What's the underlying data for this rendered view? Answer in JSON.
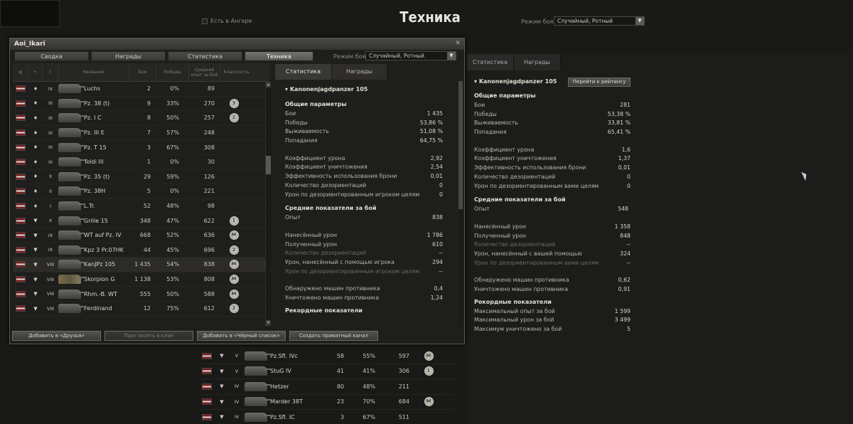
{
  "page_title": "Техника",
  "hangar_checkbox_label": "Есть в Ангаре",
  "battle_mode_label": "Режим боя:",
  "battle_mode_value": "Случайный, Ротный",
  "right_panel": {
    "tabs": [
      "Статистика",
      "Награды"
    ],
    "tank_name": "Kanonenjagdpanzer 105",
    "rating_button": "Перейти к рейтингу",
    "general_title": "Общие параметры",
    "general": [
      {
        "label": "Бои",
        "value": "281"
      },
      {
        "label": "Победы",
        "value": "53,38 %"
      },
      {
        "label": "Выживаемость",
        "value": "33,81 %"
      },
      {
        "label": "Попадания",
        "value": "65,41 %"
      }
    ],
    "coef": [
      {
        "label": "Коэффициент урона",
        "value": "1,6"
      },
      {
        "label": "Коэффициент уничтожения",
        "value": "1,37"
      },
      {
        "label": "Эффективность использования брони",
        "value": "0,01"
      },
      {
        "label": "Количество дезориентаций",
        "value": "0"
      },
      {
        "label": "Урон по дезориентированным вами целям",
        "value": "0"
      }
    ],
    "avg_title": "Средние показатели за бой",
    "avg_exp": {
      "label": "Опыт",
      "value": "548"
    },
    "avg_dmg": [
      {
        "label": "Нанесённый урон",
        "value": "1 358"
      },
      {
        "label": "Полученный урон",
        "value": "848"
      },
      {
        "label": "Количество дезориентаций",
        "value": "--"
      },
      {
        "label": "Урон, нанесённый с вашей помощью",
        "value": "324"
      },
      {
        "label": "Урон по дезориентированным вами целям",
        "value": "--"
      }
    ],
    "avg_det": [
      {
        "label": "Обнаружено машин противника",
        "value": "0,62"
      },
      {
        "label": "Уничтожено машин противника",
        "value": "0,91"
      }
    ],
    "record_title": "Рекордные показатели",
    "records": [
      {
        "label": "Максимальный опыт за бой",
        "value": "1 599"
      },
      {
        "label": "Максимальный урон за бой",
        "value": "3 499"
      },
      {
        "label": "Максимум уничтожено за бой",
        "value": "5"
      }
    ]
  },
  "window": {
    "title": "Aoi_Ikari",
    "close_glyph": "✕",
    "tabs": [
      "Сводка",
      "Награды",
      "Статистика",
      "Техника"
    ],
    "mode_label": "Режим боя:",
    "mode_value": "Случайный, Ротный",
    "headers": {
      "name": "Название",
      "battles": "Бои",
      "wins": "Победы",
      "exp_line1": "Средний",
      "exp_line2": "опыт за бой",
      "mastery": "Классность"
    },
    "rows": [
      {
        "type": "♦",
        "tier": "IV",
        "name": "Luchs",
        "battles": "2",
        "wins": "0%",
        "exp": "89",
        "badge": ""
      },
      {
        "type": "♦",
        "tier": "III",
        "name": "Pz. 38 (t)",
        "battles": "9",
        "wins": "33%",
        "exp": "270",
        "badge": "3"
      },
      {
        "type": "♦",
        "tier": "III",
        "name": "Pz. I C",
        "battles": "8",
        "wins": "50%",
        "exp": "257",
        "badge": "2"
      },
      {
        "type": "♦",
        "tier": "III",
        "name": "Pz. III E",
        "battles": "7",
        "wins": "57%",
        "exp": "248",
        "badge": ""
      },
      {
        "type": "♦",
        "tier": "III",
        "name": "Pz. T 15",
        "battles": "3",
        "wins": "67%",
        "exp": "308",
        "badge": ""
      },
      {
        "type": "♦",
        "tier": "III",
        "name": "Toldi III",
        "battles": "1",
        "wins": "0%",
        "exp": "30",
        "badge": ""
      },
      {
        "type": "♦",
        "tier": "II",
        "name": "Pz. 35 (t)",
        "battles": "29",
        "wins": "59%",
        "exp": "126",
        "badge": ""
      },
      {
        "type": "♦",
        "tier": "II",
        "name": "Pz. 38H",
        "battles": "5",
        "wins": "0%",
        "exp": "221",
        "badge": ""
      },
      {
        "type": "♦",
        "tier": "I",
        "name": "L.Tr.",
        "battles": "52",
        "wins": "48%",
        "exp": "98",
        "badge": ""
      },
      {
        "type": "▼",
        "tier": "X",
        "name": "Grille 15",
        "battles": "348",
        "wins": "47%",
        "exp": "622",
        "badge": "1"
      },
      {
        "type": "▼",
        "tier": "IX",
        "name": "WT auf Pz. IV",
        "battles": "668",
        "wins": "52%",
        "exp": "636",
        "badge": "M"
      },
      {
        "type": "▼",
        "tier": "IX",
        "name": "Kpz 3 Pr.07HK",
        "battles": "44",
        "wins": "45%",
        "exp": "696",
        "badge": "2"
      },
      {
        "type": "▼",
        "tier": "VIII",
        "name": "KanJPz 105",
        "battles": "1 435",
        "wins": "54%",
        "exp": "838",
        "badge": "M"
      },
      {
        "type": "▼",
        "tier": "VIII",
        "name": "Skorpion G",
        "battles": "1 138",
        "wins": "53%",
        "exp": "808",
        "badge": "M"
      },
      {
        "type": "▼",
        "tier": "VIII",
        "name": "Rhm.-B. WT",
        "battles": "555",
        "wins": "50%",
        "exp": "588",
        "badge": "M"
      },
      {
        "type": "▼",
        "tier": "VIII",
        "name": "Ferdinand",
        "battles": "12",
        "wins": "75%",
        "exp": "612",
        "badge": "2"
      }
    ],
    "selected_arrow": "›",
    "detail": {
      "tabs": [
        "Статистика",
        "Награды"
      ],
      "tank_name": "Kanonenjagdpanzer 105",
      "general_title": "Общие параметры",
      "general": [
        {
          "label": "Бои",
          "value": "1 435"
        },
        {
          "label": "Победы",
          "value": "53,86 %"
        },
        {
          "label": "Выживаемость",
          "value": "51,08 %"
        },
        {
          "label": "Попадания",
          "value": "64,75 %"
        }
      ],
      "coef": [
        {
          "label": "Коэффициент урона",
          "value": "2,92"
        },
        {
          "label": "Коэффициент уничтожения",
          "value": "2,54"
        },
        {
          "label": "Эффективность использования брони",
          "value": "0,01"
        },
        {
          "label": "Количество дезориентаций",
          "value": "0"
        },
        {
          "label": "Урон по дезориентированным игроком целям",
          "value": "0"
        }
      ],
      "avg_title": "Средние показатели за бой",
      "avg_exp": {
        "label": "Опыт",
        "value": "838"
      },
      "avg_dmg": [
        {
          "label": "Нанесённый урон",
          "value": "1 786"
        },
        {
          "label": "Полученный урон",
          "value": "610"
        },
        {
          "label": "Количество дезориентаций",
          "value": "--"
        },
        {
          "label": "Урон, нанесённый с помощью игрока",
          "value": "294"
        },
        {
          "label": "Урон по дезориентированным игроком целям",
          "value": "--"
        }
      ],
      "avg_det": [
        {
          "label": "Обнаружено машин противника",
          "value": "0,4"
        },
        {
          "label": "Уничтожено машин противника",
          "value": "1,24"
        }
      ],
      "record_title": "Рекордные показатели"
    },
    "buttons": [
      "Добавить в «Друзья»",
      "Пригласить в клан",
      "Добавить в «Чёрный список»",
      "Создать приватный канал"
    ]
  },
  "bg_rows": [
    {
      "type": "▼",
      "tier": "V",
      "name": "Pz.Sfl. IVc",
      "battles": "58",
      "wins": "55%",
      "exp": "597",
      "badge": "M"
    },
    {
      "type": "▼",
      "tier": "V",
      "name": "StuG IV",
      "battles": "41",
      "wins": "41%",
      "exp": "306",
      "badge": "1"
    },
    {
      "type": "▼",
      "tier": "IV",
      "name": "Hetzer",
      "battles": "80",
      "wins": "48%",
      "exp": "211",
      "badge": ""
    },
    {
      "type": "▼",
      "tier": "IV",
      "name": "Marder 38T",
      "battles": "23",
      "wins": "70%",
      "exp": "684",
      "badge": "M"
    },
    {
      "type": "▼",
      "tier": "IV",
      "name": "Pz.Sfl. IC",
      "battles": "3",
      "wins": "67%",
      "exp": "511",
      "badge": ""
    }
  ]
}
